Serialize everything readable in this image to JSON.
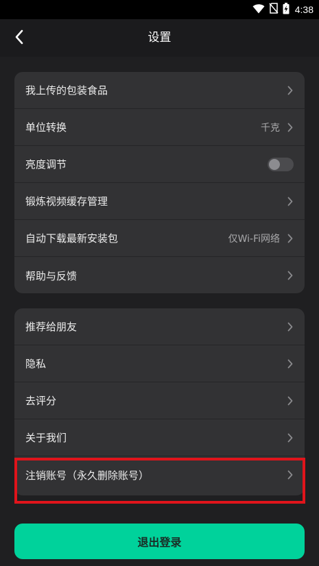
{
  "status_bar": {
    "time": "4:38",
    "icons": [
      "wifi-icon",
      "no-sim-icon",
      "battery-charging-icon"
    ]
  },
  "app_bar": {
    "title": "设置",
    "back_icon": "chevron-left-icon"
  },
  "group1": [
    {
      "label": "我上传的包装食品"
    },
    {
      "label": "单位转换",
      "value": "千克"
    },
    {
      "label": "亮度调节",
      "toggle": false
    },
    {
      "label": "锻炼视频缓存管理"
    },
    {
      "label": "自动下载最新安装包",
      "value": "仅Wi-Fi网络"
    },
    {
      "label": "帮助与反馈"
    }
  ],
  "group2": [
    {
      "label": "推荐给朋友"
    },
    {
      "label": "隐私"
    },
    {
      "label": "去评分"
    },
    {
      "label": "关于我们"
    },
    {
      "label": "注销账号（永久删除账号）"
    }
  ],
  "logout": {
    "label": "退出登录"
  },
  "colors": {
    "accent": "#00d29b",
    "highlight": "#e0141b",
    "card": "#323234",
    "background": "#1f1f21"
  }
}
